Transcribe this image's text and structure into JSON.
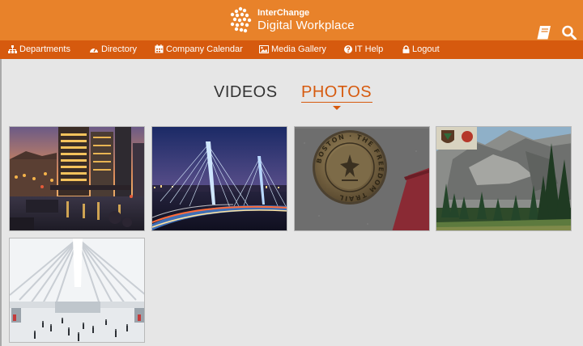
{
  "header": {
    "brand_line1": "InterChange",
    "brand_line2": "Digital Workplace",
    "icons": [
      "book-icon",
      "search-icon"
    ],
    "colors": {
      "header": "#e8822a",
      "nav": "#d65a0e",
      "background": "#e6e6e6",
      "accent": "#d65a0e"
    }
  },
  "nav": {
    "items": [
      {
        "label": "Departments",
        "icon": "sitemap-icon"
      },
      {
        "label": "Directory",
        "icon": "dashboard-icon"
      },
      {
        "label": "Company Calendar",
        "icon": "calendar-icon"
      },
      {
        "label": "Media Gallery",
        "icon": "image-icon"
      },
      {
        "label": "IT Help",
        "icon": "question-icon"
      },
      {
        "label": "Logout",
        "icon": "lock-icon"
      }
    ]
  },
  "tabs": [
    {
      "label": "VIDEOS",
      "active": false
    },
    {
      "label": "PHOTOS",
      "active": true
    }
  ],
  "gallery": {
    "photos": [
      {
        "subject": "city-waterfront-night"
      },
      {
        "subject": "cable-stayed-bridge-night"
      },
      {
        "subject": "freedom-trail-marker"
      },
      {
        "subject": "valley-cliffs-forest"
      },
      {
        "subject": "white-station-interior"
      }
    ],
    "marker_text": "BOSTON · THE FREEDOM TRAIL"
  }
}
